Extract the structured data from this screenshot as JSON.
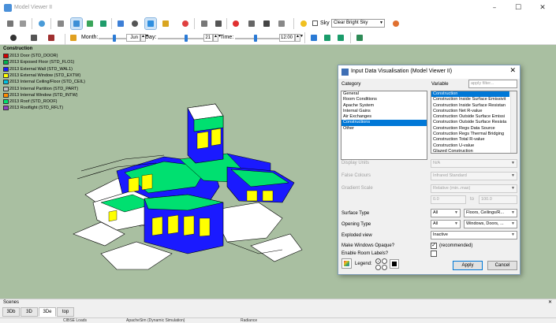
{
  "window": {
    "title": "Model Viewer II",
    "minimize": "–",
    "maximize": "☐",
    "close": "✕"
  },
  "toolbar": {
    "sky_label": "Sky",
    "sky_value": "Clear Bright Sky",
    "month_label": "Month:",
    "month_value": "Jun",
    "day_label": "Day:",
    "day_value": "21",
    "time_label": "Time:",
    "time_value": "12:00"
  },
  "legend": {
    "title": "Construction",
    "items": [
      {
        "label": "2013 Door (STD_DOOR)",
        "color": "#d40000"
      },
      {
        "label": "2013 Exposed Floor (STD_FLO1)",
        "color": "#00b050"
      },
      {
        "label": "2013 External Wall (STD_WAL1)",
        "color": "#1a1aff"
      },
      {
        "label": "2013 External Window (STD_EXTW)",
        "color": "#ffff00"
      },
      {
        "label": "2013 Internal Ceiling/Floor (STD_CEIL)",
        "color": "#00c0e0"
      },
      {
        "label": "2013 Internal Partition (STD_PART)",
        "color": "#c0c0c0"
      },
      {
        "label": "2013 Internal Window (STD_INTW)",
        "color": "#ff8c00"
      },
      {
        "label": "2013 Roof (STD_ROOF)",
        "color": "#00e070"
      },
      {
        "label": "2013 Rooflight (STD_RFLT)",
        "color": "#9040c0"
      }
    ]
  },
  "dialog": {
    "title": "Input Data Visualisation (Model Viewer II)",
    "close": "✕",
    "category_label": "Category",
    "categories": [
      "General",
      "Room Conditions",
      "Apache System",
      "Internal Gains",
      "Air Exchanges",
      "Constructions",
      "Other"
    ],
    "selected_category_index": 5,
    "variable_label": "Variable",
    "filter_placeholder": "apply filter...",
    "variables": [
      "Construction",
      "Construction Inside Surface Emissivit",
      "Construction Inside Surface Resistan",
      "Construction Net R-value",
      "Construction Outside Surface Emissi",
      "Construction Outside Surface Resista",
      "Construction Regs Data Source",
      "Construction Regs Thermal Bridging",
      "Construction Total R-value",
      "Construction U-value",
      "Glazed Construction"
    ],
    "selected_variable_index": 0,
    "display_units_label": "Display Units",
    "display_units_value": "N/A",
    "false_colours_label": "False Colours",
    "false_colours_value": "Infrared Standard",
    "gradient_scale_label": "Gradient Scale",
    "gradient_scale_value": "Relative (min..max)",
    "range_min": "0.0",
    "range_to": "to",
    "range_max": "100.0",
    "surface_type_label": "Surface Type",
    "surface_type_filter": "All",
    "surface_type_value": "Floors, Ceilings/R...",
    "opening_type_label": "Opening Type",
    "opening_type_filter": "All",
    "opening_type_value": "Windows, Doors, ...",
    "exploded_view_label": "Exploded view",
    "exploded_view_value": "Inactive",
    "windows_opaque_label": "Make Windows Opaque?",
    "windows_opaque_hint": "(recommended)",
    "room_labels_label": "Enable Room Labels?",
    "legend_label": "Legend:",
    "apply_label": "Apply",
    "cancel_label": "Cancel"
  },
  "scenes": {
    "title": "Scenes",
    "close": "✕",
    "tabs": [
      "3Db",
      "3D",
      "3De",
      "top"
    ],
    "active_tab_index": 2
  },
  "bottom_strip": [
    "CIBSE Loads",
    "ApacheSim (Dynamic Simulation)",
    "Radiance"
  ]
}
